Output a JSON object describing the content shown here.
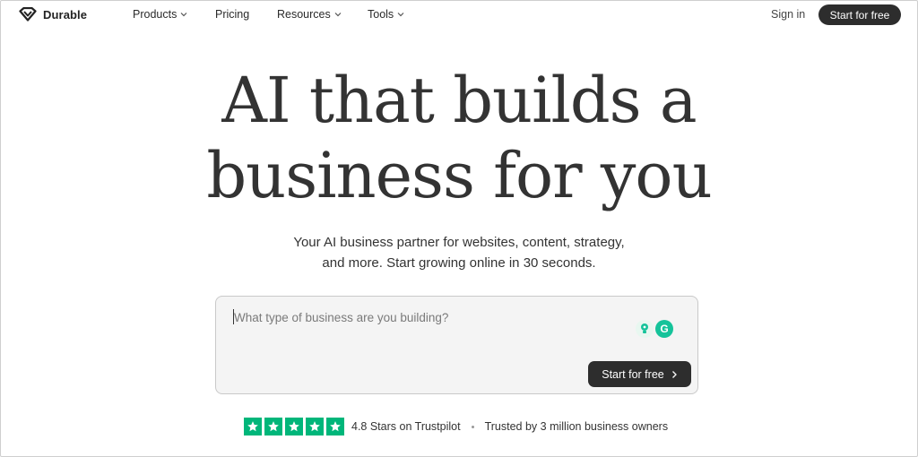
{
  "nav": {
    "logo_text": "Durable",
    "items": [
      {
        "label": "Products",
        "has_dropdown": true
      },
      {
        "label": "Pricing",
        "has_dropdown": false
      },
      {
        "label": "Resources",
        "has_dropdown": true
      },
      {
        "label": "Tools",
        "has_dropdown": true
      }
    ],
    "sign_in": "Sign in",
    "cta": "Start for free"
  },
  "hero": {
    "title_line1": "AI that builds a",
    "title_line2": "business for you",
    "subtitle_line1": "Your AI business partner for websites, content, strategy,",
    "subtitle_line2": "and more. Start growing online in 30 seconds."
  },
  "prompt": {
    "placeholder": "What type of business are you building?",
    "value": "",
    "cta": "Start for free",
    "extension_icons": [
      "grammarly-bulb-icon",
      "grammarly-g-icon"
    ],
    "extension_letter": "G"
  },
  "trust": {
    "stars": 5,
    "rating_text": "4.8 Stars on Trustpilot",
    "trusted_text": "Trusted by 3 million business owners"
  },
  "colors": {
    "text": "#2b2b2b",
    "button_bg": "#2d2d2d",
    "trustpilot_green": "#00b67a",
    "grammarly_green": "#15c39a",
    "input_bg": "#f4f4f4"
  }
}
